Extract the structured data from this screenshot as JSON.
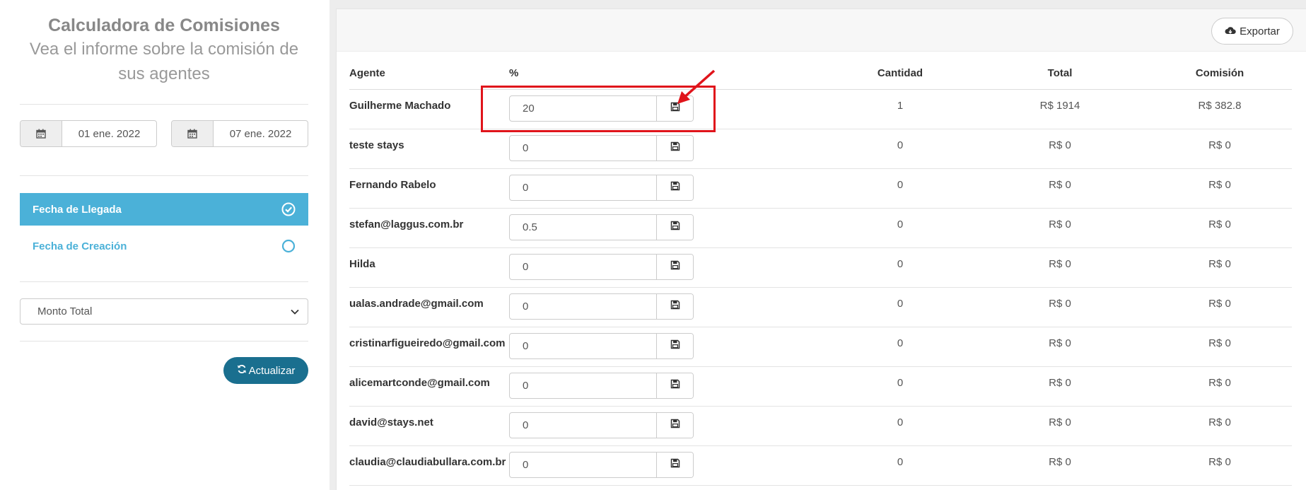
{
  "sidebar": {
    "title": "Calculadora de Comisiones",
    "subtitle_line1": "Vea el informe sobre la comisión de",
    "subtitle_line2": "sus agentes",
    "date_from": "01 ene. 2022",
    "date_to": "07 ene. 2022",
    "date_icon": "calendar-icon",
    "options": [
      {
        "label": "Fecha de Llegada",
        "selected": true
      },
      {
        "label": "Fecha de Creación",
        "selected": false
      }
    ],
    "select_value": "Monto Total",
    "update_label": "Actualizar",
    "colors": {
      "accent": "#4bb1d8",
      "update_button": "#1a6f8f"
    }
  },
  "toolbar": {
    "export_label": "Exportar",
    "export_icon": "cloud-download-icon"
  },
  "table": {
    "headers": {
      "agent": "Agente",
      "pct": "%",
      "qty": "Cantidad",
      "total": "Total",
      "commission": "Comisión"
    },
    "save_icon": "floppy-disk-icon",
    "rows": [
      {
        "agent": "Guilherme Machado",
        "pct": "20",
        "qty": "1",
        "total": "R$ 1914",
        "commission": "R$ 382.8"
      },
      {
        "agent": "teste stays",
        "pct": "0",
        "qty": "0",
        "total": "R$ 0",
        "commission": "R$ 0"
      },
      {
        "agent": "Fernando Rabelo",
        "pct": "0",
        "qty": "0",
        "total": "R$ 0",
        "commission": "R$ 0"
      },
      {
        "agent": "stefan@laggus.com.br",
        "pct": "0.5",
        "qty": "0",
        "total": "R$ 0",
        "commission": "R$ 0"
      },
      {
        "agent": "Hilda",
        "pct": "0",
        "qty": "0",
        "total": "R$ 0",
        "commission": "R$ 0"
      },
      {
        "agent": "ualas.andrade@gmail.com",
        "pct": "0",
        "qty": "0",
        "total": "R$ 0",
        "commission": "R$ 0"
      },
      {
        "agent": "cristinarfigueiredo@gmail.com",
        "pct": "0",
        "qty": "0",
        "total": "R$ 0",
        "commission": "R$ 0"
      },
      {
        "agent": "alicemartconde@gmail.com",
        "pct": "0",
        "qty": "0",
        "total": "R$ 0",
        "commission": "R$ 0"
      },
      {
        "agent": "david@stays.net",
        "pct": "0",
        "qty": "0",
        "total": "R$ 0",
        "commission": "R$ 0"
      },
      {
        "agent": "claudia@claudiabullara.com.br",
        "pct": "0",
        "qty": "0",
        "total": "R$ 0",
        "commission": "R$ 0"
      }
    ]
  },
  "annotation": {
    "color": "#e0141b"
  }
}
